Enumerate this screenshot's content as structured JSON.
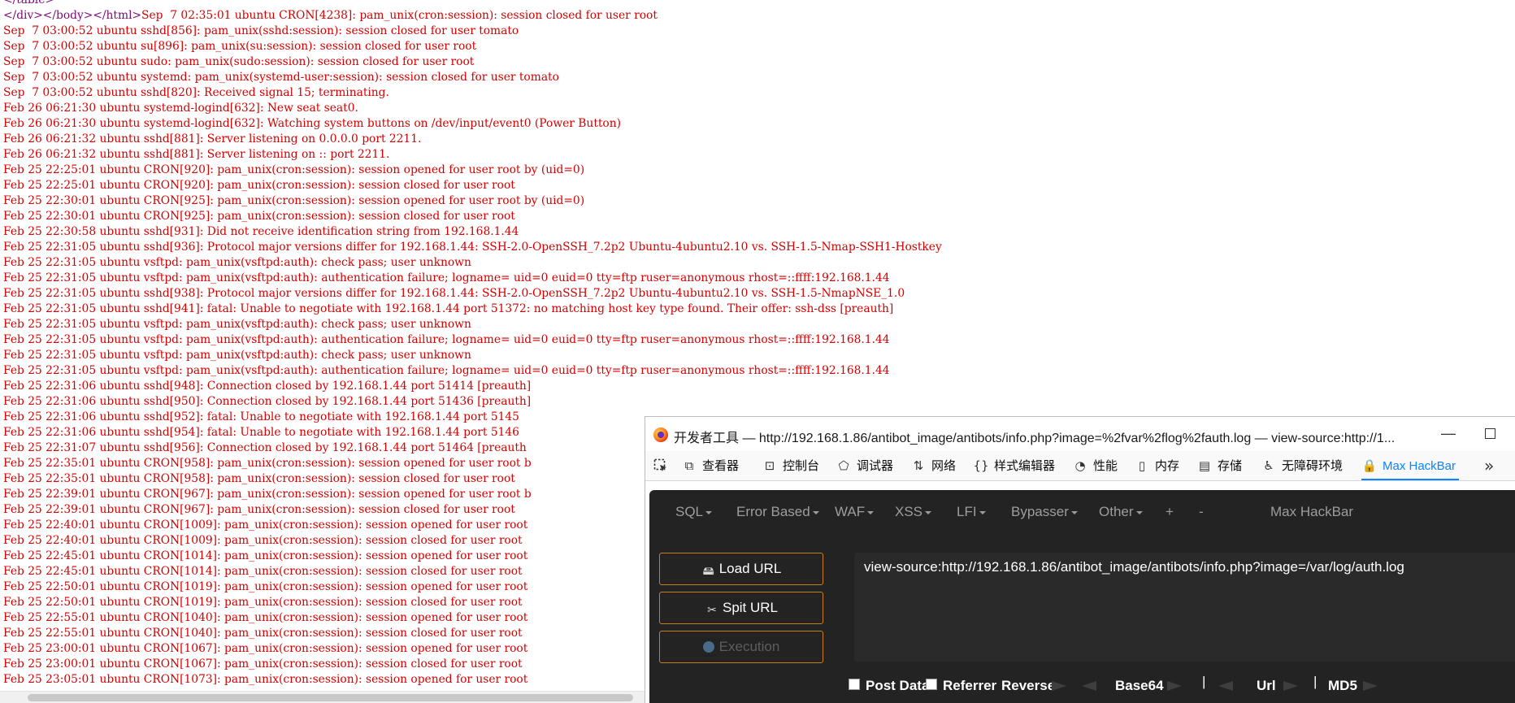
{
  "source_view": {
    "lines": [
      {
        "tag": "</table>",
        "text": ""
      },
      {
        "tag": "</div></body></html>",
        "text": "Sep  7 02:35:01 ubuntu CRON[4238]: pam_unix(cron:session): session closed for user root"
      },
      {
        "tag": "",
        "text": "Sep  7 03:00:52 ubuntu sshd[856]: pam_unix(sshd:session): session closed for user tomato"
      },
      {
        "tag": "",
        "text": "Sep  7 03:00:52 ubuntu su[896]: pam_unix(su:session): session closed for user root"
      },
      {
        "tag": "",
        "text": "Sep  7 03:00:52 ubuntu sudo: pam_unix(sudo:session): session closed for user root"
      },
      {
        "tag": "",
        "text": "Sep  7 03:00:52 ubuntu systemd: pam_unix(systemd-user:session): session closed for user tomato"
      },
      {
        "tag": "",
        "text": "Sep  7 03:00:52 ubuntu sshd[820]: Received signal 15; terminating."
      },
      {
        "tag": "",
        "text": "Feb 26 06:21:30 ubuntu systemd-logind[632]: New seat seat0."
      },
      {
        "tag": "",
        "text": "Feb 26 06:21:30 ubuntu systemd-logind[632]: Watching system buttons on /dev/input/event0 (Power Button)"
      },
      {
        "tag": "",
        "text": "Feb 26 06:21:32 ubuntu sshd[881]: Server listening on 0.0.0.0 port 2211."
      },
      {
        "tag": "",
        "text": "Feb 26 06:21:32 ubuntu sshd[881]: Server listening on :: port 2211."
      },
      {
        "tag": "",
        "text": "Feb 25 22:25:01 ubuntu CRON[920]: pam_unix(cron:session): session opened for user root by (uid=0)"
      },
      {
        "tag": "",
        "text": "Feb 25 22:25:01 ubuntu CRON[920]: pam_unix(cron:session): session closed for user root"
      },
      {
        "tag": "",
        "text": "Feb 25 22:30:01 ubuntu CRON[925]: pam_unix(cron:session): session opened for user root by (uid=0)"
      },
      {
        "tag": "",
        "text": "Feb 25 22:30:01 ubuntu CRON[925]: pam_unix(cron:session): session closed for user root"
      },
      {
        "tag": "",
        "text": "Feb 25 22:30:58 ubuntu sshd[931]: Did not receive identification string from 192.168.1.44"
      },
      {
        "tag": "",
        "text": "Feb 25 22:31:05 ubuntu sshd[936]: Protocol major versions differ for 192.168.1.44: SSH-2.0-OpenSSH_7.2p2 Ubuntu-4ubuntu2.10 vs. SSH-1.5-Nmap-SSH1-Hostkey"
      },
      {
        "tag": "",
        "text": "Feb 25 22:31:05 ubuntu vsftpd: pam_unix(vsftpd:auth): check pass; user unknown"
      },
      {
        "tag": "",
        "text": "Feb 25 22:31:05 ubuntu vsftpd: pam_unix(vsftpd:auth): authentication failure; logname= uid=0 euid=0 tty=ftp ruser=anonymous rhost=::ffff:192.168.1.44"
      },
      {
        "tag": "",
        "text": "Feb 25 22:31:05 ubuntu sshd[938]: Protocol major versions differ for 192.168.1.44: SSH-2.0-OpenSSH_7.2p2 Ubuntu-4ubuntu2.10 vs. SSH-1.5-NmapNSE_1.0"
      },
      {
        "tag": "",
        "text": "Feb 25 22:31:05 ubuntu sshd[941]: fatal: Unable to negotiate with 192.168.1.44 port 51372: no matching host key type found. Their offer: ssh-dss [preauth]"
      },
      {
        "tag": "",
        "text": "Feb 25 22:31:05 ubuntu vsftpd: pam_unix(vsftpd:auth): check pass; user unknown"
      },
      {
        "tag": "",
        "text": "Feb 25 22:31:05 ubuntu vsftpd: pam_unix(vsftpd:auth): authentication failure; logname= uid=0 euid=0 tty=ftp ruser=anonymous rhost=::ffff:192.168.1.44"
      },
      {
        "tag": "",
        "text": "Feb 25 22:31:05 ubuntu vsftpd: pam_unix(vsftpd:auth): check pass; user unknown"
      },
      {
        "tag": "",
        "text": "Feb 25 22:31:05 ubuntu vsftpd: pam_unix(vsftpd:auth): authentication failure; logname= uid=0 euid=0 tty=ftp ruser=anonymous rhost=::ffff:192.168.1.44"
      },
      {
        "tag": "",
        "text": "Feb 25 22:31:06 ubuntu sshd[948]: Connection closed by 192.168.1.44 port 51414 [preauth]"
      },
      {
        "tag": "",
        "text": "Feb 25 22:31:06 ubuntu sshd[950]: Connection closed by 192.168.1.44 port 51436 [preauth]"
      },
      {
        "tag": "",
        "text": "Feb 25 22:31:06 ubuntu sshd[952]: fatal: Unable to negotiate with 192.168.1.44 port 5145"
      },
      {
        "tag": "",
        "text": "Feb 25 22:31:06 ubuntu sshd[954]: fatal: Unable to negotiate with 192.168.1.44 port 5146"
      },
      {
        "tag": "",
        "text": "Feb 25 22:31:07 ubuntu sshd[956]: Connection closed by 192.168.1.44 port 51464 [preauth"
      },
      {
        "tag": "",
        "text": "Feb 25 22:35:01 ubuntu CRON[958]: pam_unix(cron:session): session opened for user root b"
      },
      {
        "tag": "",
        "text": "Feb 25 22:35:01 ubuntu CRON[958]: pam_unix(cron:session): session closed for user root"
      },
      {
        "tag": "",
        "text": "Feb 25 22:39:01 ubuntu CRON[967]: pam_unix(cron:session): session opened for user root b"
      },
      {
        "tag": "",
        "text": "Feb 25 22:39:01 ubuntu CRON[967]: pam_unix(cron:session): session closed for user root"
      },
      {
        "tag": "",
        "text": "Feb 25 22:40:01 ubuntu CRON[1009]: pam_unix(cron:session): session opened for user root"
      },
      {
        "tag": "",
        "text": "Feb 25 22:40:01 ubuntu CRON[1009]: pam_unix(cron:session): session closed for user root"
      },
      {
        "tag": "",
        "text": "Feb 25 22:45:01 ubuntu CRON[1014]: pam_unix(cron:session): session opened for user root"
      },
      {
        "tag": "",
        "text": "Feb 25 22:45:01 ubuntu CRON[1014]: pam_unix(cron:session): session closed for user root"
      },
      {
        "tag": "",
        "text": "Feb 25 22:50:01 ubuntu CRON[1019]: pam_unix(cron:session): session opened for user root"
      },
      {
        "tag": "",
        "text": "Feb 25 22:50:01 ubuntu CRON[1019]: pam_unix(cron:session): session closed for user root"
      },
      {
        "tag": "",
        "text": "Feb 25 22:55:01 ubuntu CRON[1040]: pam_unix(cron:session): session opened for user root"
      },
      {
        "tag": "",
        "text": "Feb 25 22:55:01 ubuntu CRON[1040]: pam_unix(cron:session): session closed for user root"
      },
      {
        "tag": "",
        "text": "Feb 25 23:00:01 ubuntu CRON[1067]: pam_unix(cron:session): session opened for user root"
      },
      {
        "tag": "",
        "text": "Feb 25 23:00:01 ubuntu CRON[1067]: pam_unix(cron:session): session closed for user root"
      },
      {
        "tag": "",
        "text": "Feb 25 23:05:01 ubuntu CRON[1073]: pam_unix(cron:session): session opened for user root"
      }
    ]
  },
  "devtools": {
    "window_title": "开发者工具 — http://192.168.1.86/antibot_image/antibots/info.php?image=%2fvar%2flog%2fauth.log — view-source:http://1...",
    "window_controls": {
      "minimize": "—"
    },
    "tabs": [
      {
        "label": "查看器",
        "icon": "inspector-icon",
        "glyph": "⧉"
      },
      {
        "label": "控制台",
        "icon": "console-icon",
        "glyph": "⊡"
      },
      {
        "label": "调试器",
        "icon": "debugger-icon",
        "glyph": "⬠"
      },
      {
        "label": "网络",
        "icon": "network-icon",
        "glyph": "⇅"
      },
      {
        "label": "样式编辑器",
        "icon": "style-editor-icon",
        "glyph": "{}"
      },
      {
        "label": "性能",
        "icon": "performance-icon",
        "glyph": "◔"
      },
      {
        "label": "内存",
        "icon": "memory-icon",
        "glyph": "▯"
      },
      {
        "label": "存储",
        "icon": "storage-icon",
        "glyph": "▤"
      },
      {
        "label": "无障碍环境",
        "icon": "accessibility-icon",
        "glyph": "♿"
      },
      {
        "label": "Max HackBar",
        "icon": "hackbar-lock-icon",
        "glyph": "🔒"
      }
    ],
    "overflow_glyph": "»",
    "accent_color": "#0a84ff"
  },
  "hackbar": {
    "menu": [
      "SQL",
      "Error Based",
      "WAF",
      "XSS",
      "LFI",
      "Bypasser",
      "Other",
      "+",
      "-"
    ],
    "brand": "Max HackBar",
    "buttons": {
      "load_url": "Load URL",
      "split_url": "Spit URL",
      "execution": "Execution"
    },
    "url_value": "view-source:http://192.168.1.86/antibot_image/antibots/info.php?image=/var/log/auth.log",
    "options": {
      "post_data": "Post Data",
      "referrer": "Referrer",
      "reverse": "Reverse",
      "base64": "Base64",
      "url": "Url",
      "md5": "MD5"
    },
    "colors": {
      "panel_bg": "#232323",
      "button_border": "#c77d1e",
      "log_text": "#d40000"
    }
  }
}
